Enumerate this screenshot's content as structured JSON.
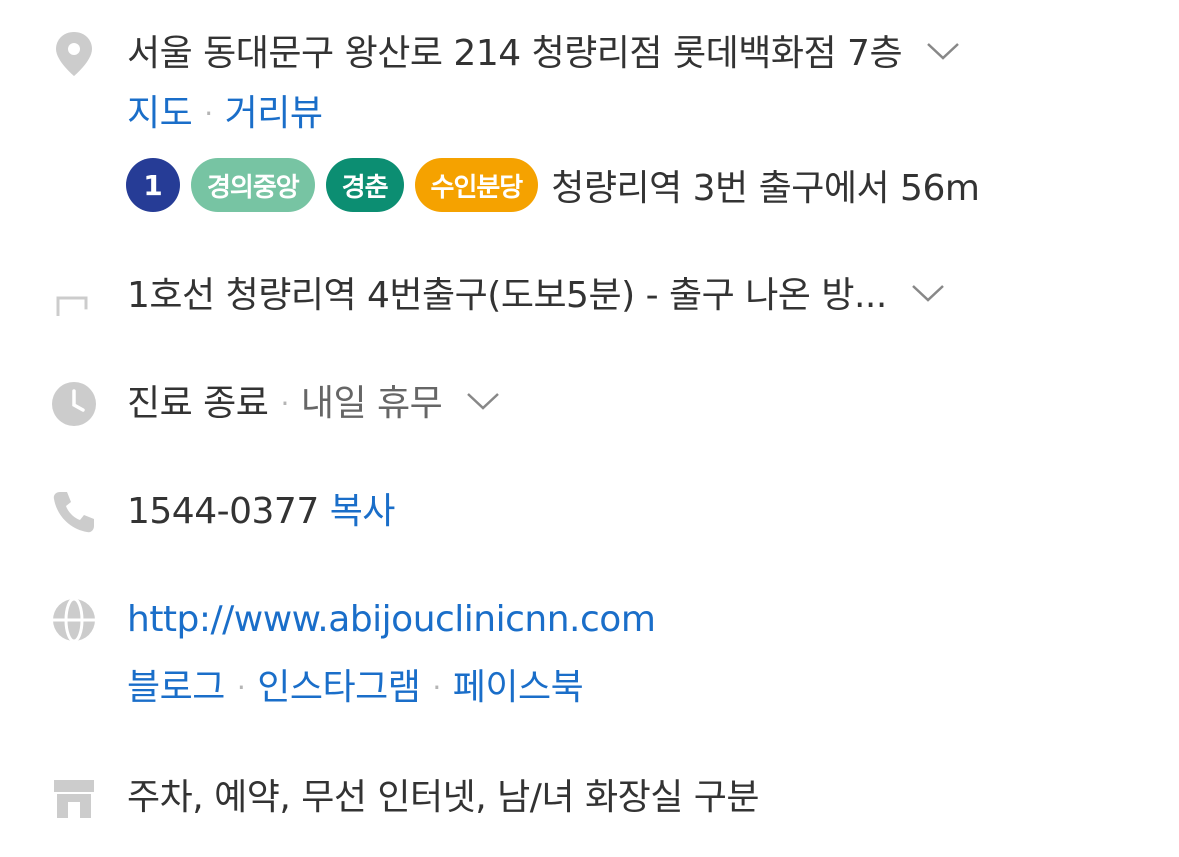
{
  "address": {
    "text": "서울 동대문구 왕산로 214 청량리점 롯데백화점 7층",
    "links": {
      "map": "지도",
      "separator": "·",
      "street_view": "거리뷰"
    },
    "transit": {
      "line_number": "1",
      "lines": [
        {
          "label": "경의중앙",
          "color": "#77c4a3"
        },
        {
          "label": "경춘",
          "color": "#0c8e72"
        },
        {
          "label": "수인분당",
          "color": "#f5a200"
        }
      ],
      "line_number_color": "#263c96",
      "nearby_text": "청량리역 3번 출구에서 56m"
    }
  },
  "directions": {
    "text": "1호선 청량리역 4번출구(도보5분) - 출구 나온 방..."
  },
  "hours": {
    "status": "진료 종료",
    "separator": "·",
    "next": "내일 휴무"
  },
  "phone": {
    "number": "1544-0377",
    "copy_label": "복사"
  },
  "website": {
    "url": "http://www.abijouclinicnn.com",
    "socials": [
      "블로그",
      "인스타그램",
      "페이스북"
    ],
    "separator": "·"
  },
  "amenities": {
    "text": "주차, 예약, 무선 인터넷, 남/녀 화장실 구분"
  },
  "colors": {
    "link": "#1a6ec9",
    "icon": "#cccccc",
    "text": "#333333"
  },
  "icons": [
    "location-pin-icon",
    "directions-arrow-icon",
    "clock-icon",
    "phone-icon",
    "globe-icon",
    "store-icon",
    "chevron-down-icon"
  ]
}
